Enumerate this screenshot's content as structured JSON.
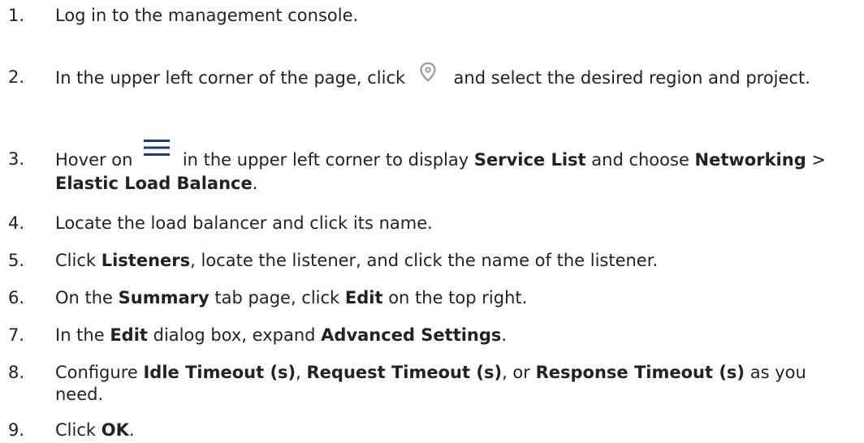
{
  "steps": [
    {
      "num": "1.",
      "parts": [
        {
          "t": "Log in to the management console."
        }
      ]
    },
    {
      "num": "2.",
      "parts": [
        {
          "t": "In the upper left corner of the page, click "
        },
        {
          "icon": "location-pin-icon"
        },
        {
          "t": " and select the desired region and project."
        }
      ]
    },
    {
      "num": "3.",
      "parts": [
        {
          "t": "Hover on "
        },
        {
          "icon": "hamburger-menu-icon"
        },
        {
          "t": " in the upper left corner to display "
        },
        {
          "t": "Service List",
          "b": true
        },
        {
          "t": " and choose "
        },
        {
          "t": "Networking",
          "b": true
        },
        {
          "t": " > "
        },
        {
          "t": "Elastic Load Balance",
          "b": true
        },
        {
          "t": "."
        }
      ]
    },
    {
      "num": "4.",
      "parts": [
        {
          "t": "Locate the load balancer and click its name."
        }
      ]
    },
    {
      "num": "5.",
      "parts": [
        {
          "t": "Click "
        },
        {
          "t": "Listeners",
          "b": true
        },
        {
          "t": ", locate the listener, and click the name of the listener."
        }
      ]
    },
    {
      "num": "6.",
      "parts": [
        {
          "t": "On the "
        },
        {
          "t": "Summary",
          "b": true
        },
        {
          "t": " tab page, click "
        },
        {
          "t": "Edit",
          "b": true
        },
        {
          "t": " on the top right."
        }
      ]
    },
    {
      "num": "7.",
      "parts": [
        {
          "t": "In the "
        },
        {
          "t": "Edit",
          "b": true
        },
        {
          "t": " dialog box, expand "
        },
        {
          "t": "Advanced Settings",
          "b": true
        },
        {
          "t": "."
        }
      ]
    },
    {
      "num": "8.",
      "parts": [
        {
          "t": "Configure "
        },
        {
          "t": "Idle Timeout (s)",
          "b": true
        },
        {
          "t": ", "
        },
        {
          "t": "Request Timeout (s)",
          "b": true
        },
        {
          "t": ", or "
        },
        {
          "t": "Response Timeout (s)",
          "b": true
        },
        {
          "t": " as you need."
        }
      ]
    },
    {
      "num": "9.",
      "parts": [
        {
          "t": "Click "
        },
        {
          "t": "OK",
          "b": true
        },
        {
          "t": "."
        }
      ]
    }
  ],
  "colors": {
    "text": "#222222",
    "icon": "#9a9a9a",
    "menu_icon": "#1f3b73"
  }
}
